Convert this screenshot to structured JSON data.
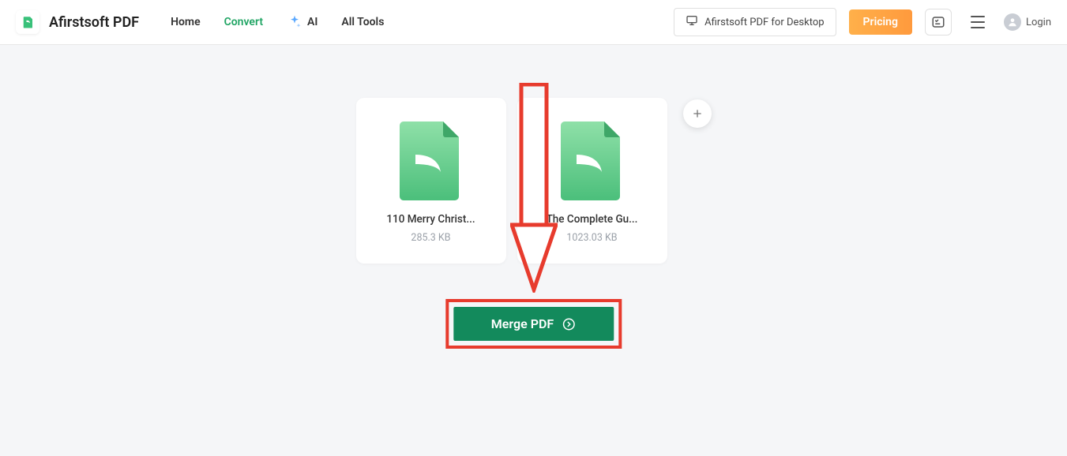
{
  "brand": "Afirstsoft PDF",
  "nav": {
    "home": "Home",
    "convert": "Convert",
    "ai": "AI",
    "all_tools": "All Tools"
  },
  "header": {
    "desktop_label": "Afirstsoft PDF for Desktop",
    "pricing_label": "Pricing",
    "login_label": "Login"
  },
  "files": [
    {
      "name": "110 Merry Christ...",
      "size": "285.3 KB"
    },
    {
      "name": "The Complete Gu...",
      "size": "1023.03 KB"
    }
  ],
  "action": {
    "merge_label": "Merge PDF"
  },
  "colors": {
    "accent_green": "#138a5c",
    "annotation_red": "#e73b2d",
    "pricing_orange": "#ff9a3d"
  }
}
